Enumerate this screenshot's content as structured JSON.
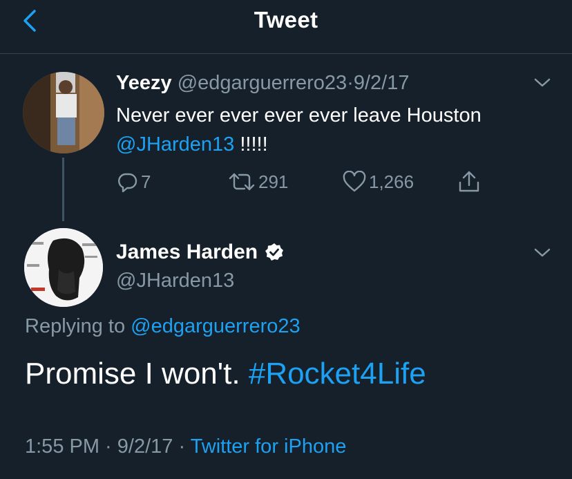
{
  "header": {
    "title": "Tweet"
  },
  "tweet1": {
    "name": "Yeezy",
    "handle": "@edgarguerrero23",
    "separator": "·",
    "date": "9/2/17",
    "text": "Never ever ever ever ever leave Houston",
    "mention": "@JHarden13",
    "text_suffix": " !!!!!",
    "actions": {
      "replies": "7",
      "retweets": "291",
      "likes": "1,266"
    }
  },
  "tweet2": {
    "name": "James Harden",
    "handle": "@JHarden13",
    "replying_prefix": "Replying to ",
    "replying_handle": "@edgarguerrero23",
    "text": "Promise I won't. ",
    "hashtag": "#Rocket4Life",
    "time": "1:55 PM",
    "separator": " · ",
    "date": "9/2/17",
    "source": "Twitter for iPhone"
  },
  "colors": {
    "background": "#15202b",
    "accent": "#1da1f2",
    "muted": "#8899a6",
    "divider": "#38444d"
  },
  "icons": [
    "back-arrow-icon",
    "chevron-down-icon",
    "reply-icon",
    "retweet-icon",
    "like-icon",
    "share-icon",
    "verified-icon"
  ]
}
